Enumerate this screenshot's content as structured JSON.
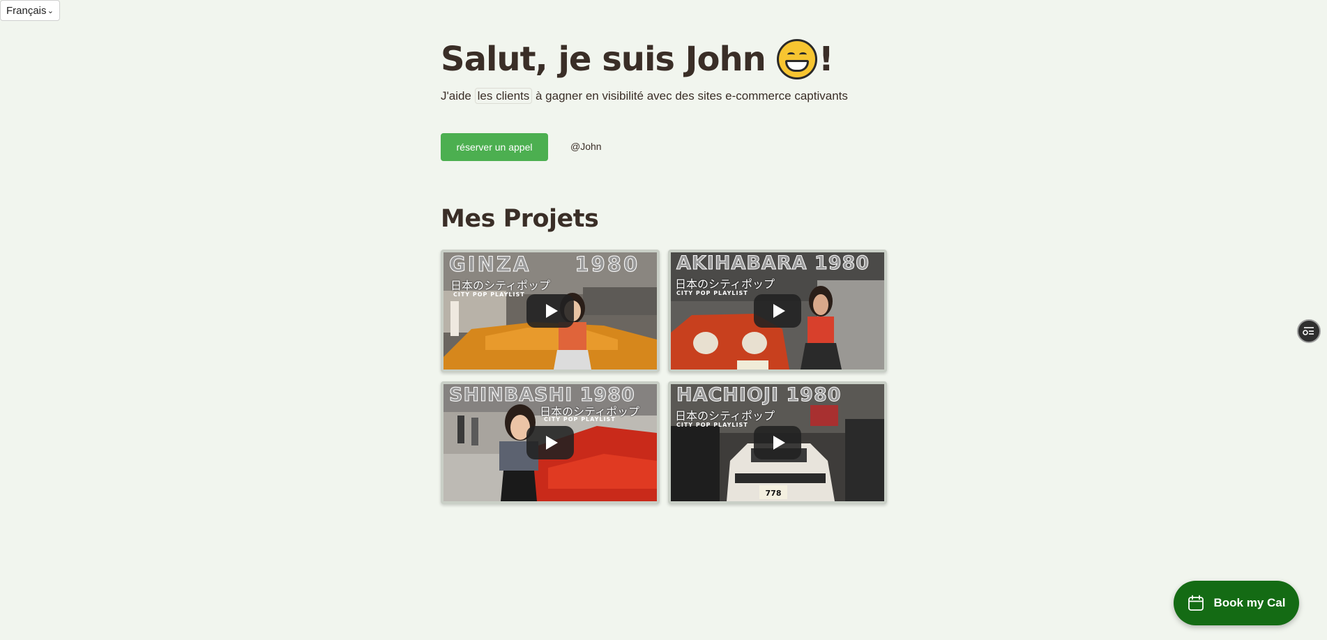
{
  "language_select": {
    "value": "Français"
  },
  "hero": {
    "title": "Salut, je suis John",
    "title_end": "!",
    "emoji": "grinning-face-icon",
    "subtitle_before": "J'aide",
    "subtitle_highlight": "les clients",
    "subtitle_after": "à gagner en visibilité avec des sites e-commerce captivants"
  },
  "actions": {
    "cta_label": "réserver un appel",
    "handle": "@John"
  },
  "projects": {
    "title": "Mes Projets",
    "videos": [
      {
        "title": "GINZA 1980",
        "jp": "日本のシティポップ",
        "tag": "CITY POP PLAYLIST"
      },
      {
        "title": "AKIHABARA 1980",
        "jp": "日本のシティポップ",
        "tag": "CITY POP PLAYLIST"
      },
      {
        "title": "SHINBASHI 1980",
        "jp": "日本のシティポップ",
        "tag": "CITY POP PLAYLIST"
      },
      {
        "title": "HACHIOJI 1980",
        "jp": "日本のシティポップ",
        "tag": "CITY POP PLAYLIST"
      }
    ]
  },
  "floating": {
    "book_label": "Book my Cal",
    "book_bg": "#146b14",
    "cta_bg": "#4caf50",
    "page_bg": "#f1f5ee"
  }
}
